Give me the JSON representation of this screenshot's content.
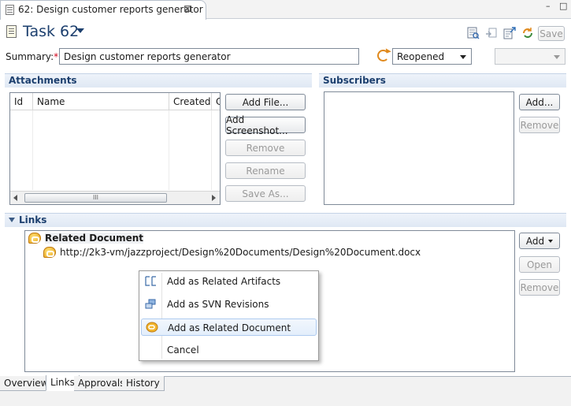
{
  "editor_tab": {
    "title": "62: Design customer reports generator",
    "close_glyph": "⊠",
    "icon": "task-document-icon"
  },
  "window_controls": {
    "minimize": "–",
    "maximize": "□"
  },
  "header": {
    "title": "Task 62",
    "toolbar_icons": [
      "find-related-icon",
      "locate-icon",
      "open-in-browser-icon",
      "refresh-sync-icon"
    ],
    "save_label": "Save"
  },
  "summary": {
    "label": "Summary:",
    "required_mark": "*",
    "value": "Design customer reports generator",
    "state_value": "Reopened",
    "resolution_value": ""
  },
  "attachments": {
    "title": "Attachments",
    "columns": [
      "Id",
      "Name",
      "Created",
      "Cre"
    ],
    "rows": [],
    "scroll_thumb_glyph": "III",
    "buttons": {
      "add_file": "Add File...",
      "add_screenshot": "Add Screenshot...",
      "remove": "Remove",
      "rename": "Rename",
      "save_as": "Save As..."
    }
  },
  "subscribers": {
    "title": "Subscribers",
    "items": [],
    "buttons": {
      "add": "Add...",
      "remove": "Remove"
    }
  },
  "links": {
    "title": "Links",
    "tree": {
      "group_label": "Related Document",
      "items": [
        "http://2k3-vm/jazzproject/Design%20Documents/Design%20Document.docx"
      ]
    },
    "buttons": {
      "add": "Add",
      "open": "Open",
      "remove": "Remove"
    }
  },
  "context_menu": {
    "items": [
      {
        "label": "Add as Related Artifacts",
        "icon": "related-artifacts-icon"
      },
      {
        "label": "Add as SVN Revisions",
        "icon": "svn-revisions-icon"
      },
      {
        "label": "Add as Related Document",
        "icon": "related-document-icon"
      },
      {
        "label": "Cancel",
        "icon": ""
      }
    ],
    "highlighted_item": "Add as Related Document"
  },
  "bottom_tabs": {
    "tabs": [
      "Overview",
      "Links",
      "Approvals",
      "History"
    ],
    "active": "Links"
  },
  "colors": {
    "title_blue": "#1c3f6e",
    "section_header_bg": "#dfe8f4",
    "required_red": "#d0021b",
    "link_icon_gold": "#e7a21a",
    "state_icon_orange": "#e0891c"
  }
}
